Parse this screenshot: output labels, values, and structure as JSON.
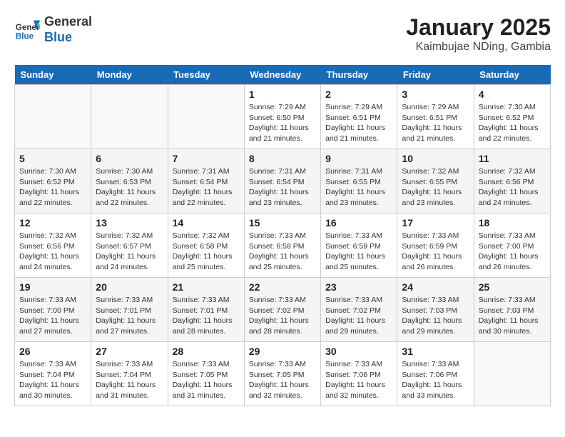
{
  "header": {
    "logo_line1": "General",
    "logo_line2": "Blue",
    "title": "January 2025",
    "subtitle": "Kaimbujae NDing, Gambia"
  },
  "days_of_week": [
    "Sunday",
    "Monday",
    "Tuesday",
    "Wednesday",
    "Thursday",
    "Friday",
    "Saturday"
  ],
  "weeks": [
    [
      {
        "day": "",
        "info": ""
      },
      {
        "day": "",
        "info": ""
      },
      {
        "day": "",
        "info": ""
      },
      {
        "day": "1",
        "info": "Sunrise: 7:29 AM\nSunset: 6:50 PM\nDaylight: 11 hours and 21 minutes."
      },
      {
        "day": "2",
        "info": "Sunrise: 7:29 AM\nSunset: 6:51 PM\nDaylight: 11 hours and 21 minutes."
      },
      {
        "day": "3",
        "info": "Sunrise: 7:29 AM\nSunset: 6:51 PM\nDaylight: 11 hours and 21 minutes."
      },
      {
        "day": "4",
        "info": "Sunrise: 7:30 AM\nSunset: 6:52 PM\nDaylight: 11 hours and 22 minutes."
      }
    ],
    [
      {
        "day": "5",
        "info": "Sunrise: 7:30 AM\nSunset: 6:52 PM\nDaylight: 11 hours and 22 minutes."
      },
      {
        "day": "6",
        "info": "Sunrise: 7:30 AM\nSunset: 6:53 PM\nDaylight: 11 hours and 22 minutes."
      },
      {
        "day": "7",
        "info": "Sunrise: 7:31 AM\nSunset: 6:54 PM\nDaylight: 11 hours and 22 minutes."
      },
      {
        "day": "8",
        "info": "Sunrise: 7:31 AM\nSunset: 6:54 PM\nDaylight: 11 hours and 23 minutes."
      },
      {
        "day": "9",
        "info": "Sunrise: 7:31 AM\nSunset: 6:55 PM\nDaylight: 11 hours and 23 minutes."
      },
      {
        "day": "10",
        "info": "Sunrise: 7:32 AM\nSunset: 6:55 PM\nDaylight: 11 hours and 23 minutes."
      },
      {
        "day": "11",
        "info": "Sunrise: 7:32 AM\nSunset: 6:56 PM\nDaylight: 11 hours and 24 minutes."
      }
    ],
    [
      {
        "day": "12",
        "info": "Sunrise: 7:32 AM\nSunset: 6:56 PM\nDaylight: 11 hours and 24 minutes."
      },
      {
        "day": "13",
        "info": "Sunrise: 7:32 AM\nSunset: 6:57 PM\nDaylight: 11 hours and 24 minutes."
      },
      {
        "day": "14",
        "info": "Sunrise: 7:32 AM\nSunset: 6:58 PM\nDaylight: 11 hours and 25 minutes."
      },
      {
        "day": "15",
        "info": "Sunrise: 7:33 AM\nSunset: 6:58 PM\nDaylight: 11 hours and 25 minutes."
      },
      {
        "day": "16",
        "info": "Sunrise: 7:33 AM\nSunset: 6:59 PM\nDaylight: 11 hours and 25 minutes."
      },
      {
        "day": "17",
        "info": "Sunrise: 7:33 AM\nSunset: 6:59 PM\nDaylight: 11 hours and 26 minutes."
      },
      {
        "day": "18",
        "info": "Sunrise: 7:33 AM\nSunset: 7:00 PM\nDaylight: 11 hours and 26 minutes."
      }
    ],
    [
      {
        "day": "19",
        "info": "Sunrise: 7:33 AM\nSunset: 7:00 PM\nDaylight: 11 hours and 27 minutes."
      },
      {
        "day": "20",
        "info": "Sunrise: 7:33 AM\nSunset: 7:01 PM\nDaylight: 11 hours and 27 minutes."
      },
      {
        "day": "21",
        "info": "Sunrise: 7:33 AM\nSunset: 7:01 PM\nDaylight: 11 hours and 28 minutes."
      },
      {
        "day": "22",
        "info": "Sunrise: 7:33 AM\nSunset: 7:02 PM\nDaylight: 11 hours and 28 minutes."
      },
      {
        "day": "23",
        "info": "Sunrise: 7:33 AM\nSunset: 7:02 PM\nDaylight: 11 hours and 29 minutes."
      },
      {
        "day": "24",
        "info": "Sunrise: 7:33 AM\nSunset: 7:03 PM\nDaylight: 11 hours and 29 minutes."
      },
      {
        "day": "25",
        "info": "Sunrise: 7:33 AM\nSunset: 7:03 PM\nDaylight: 11 hours and 30 minutes."
      }
    ],
    [
      {
        "day": "26",
        "info": "Sunrise: 7:33 AM\nSunset: 7:04 PM\nDaylight: 11 hours and 30 minutes."
      },
      {
        "day": "27",
        "info": "Sunrise: 7:33 AM\nSunset: 7:04 PM\nDaylight: 11 hours and 31 minutes."
      },
      {
        "day": "28",
        "info": "Sunrise: 7:33 AM\nSunset: 7:05 PM\nDaylight: 11 hours and 31 minutes."
      },
      {
        "day": "29",
        "info": "Sunrise: 7:33 AM\nSunset: 7:05 PM\nDaylight: 11 hours and 32 minutes."
      },
      {
        "day": "30",
        "info": "Sunrise: 7:33 AM\nSunset: 7:06 PM\nDaylight: 11 hours and 32 minutes."
      },
      {
        "day": "31",
        "info": "Sunrise: 7:33 AM\nSunset: 7:06 PM\nDaylight: 11 hours and 33 minutes."
      },
      {
        "day": "",
        "info": ""
      }
    ]
  ]
}
